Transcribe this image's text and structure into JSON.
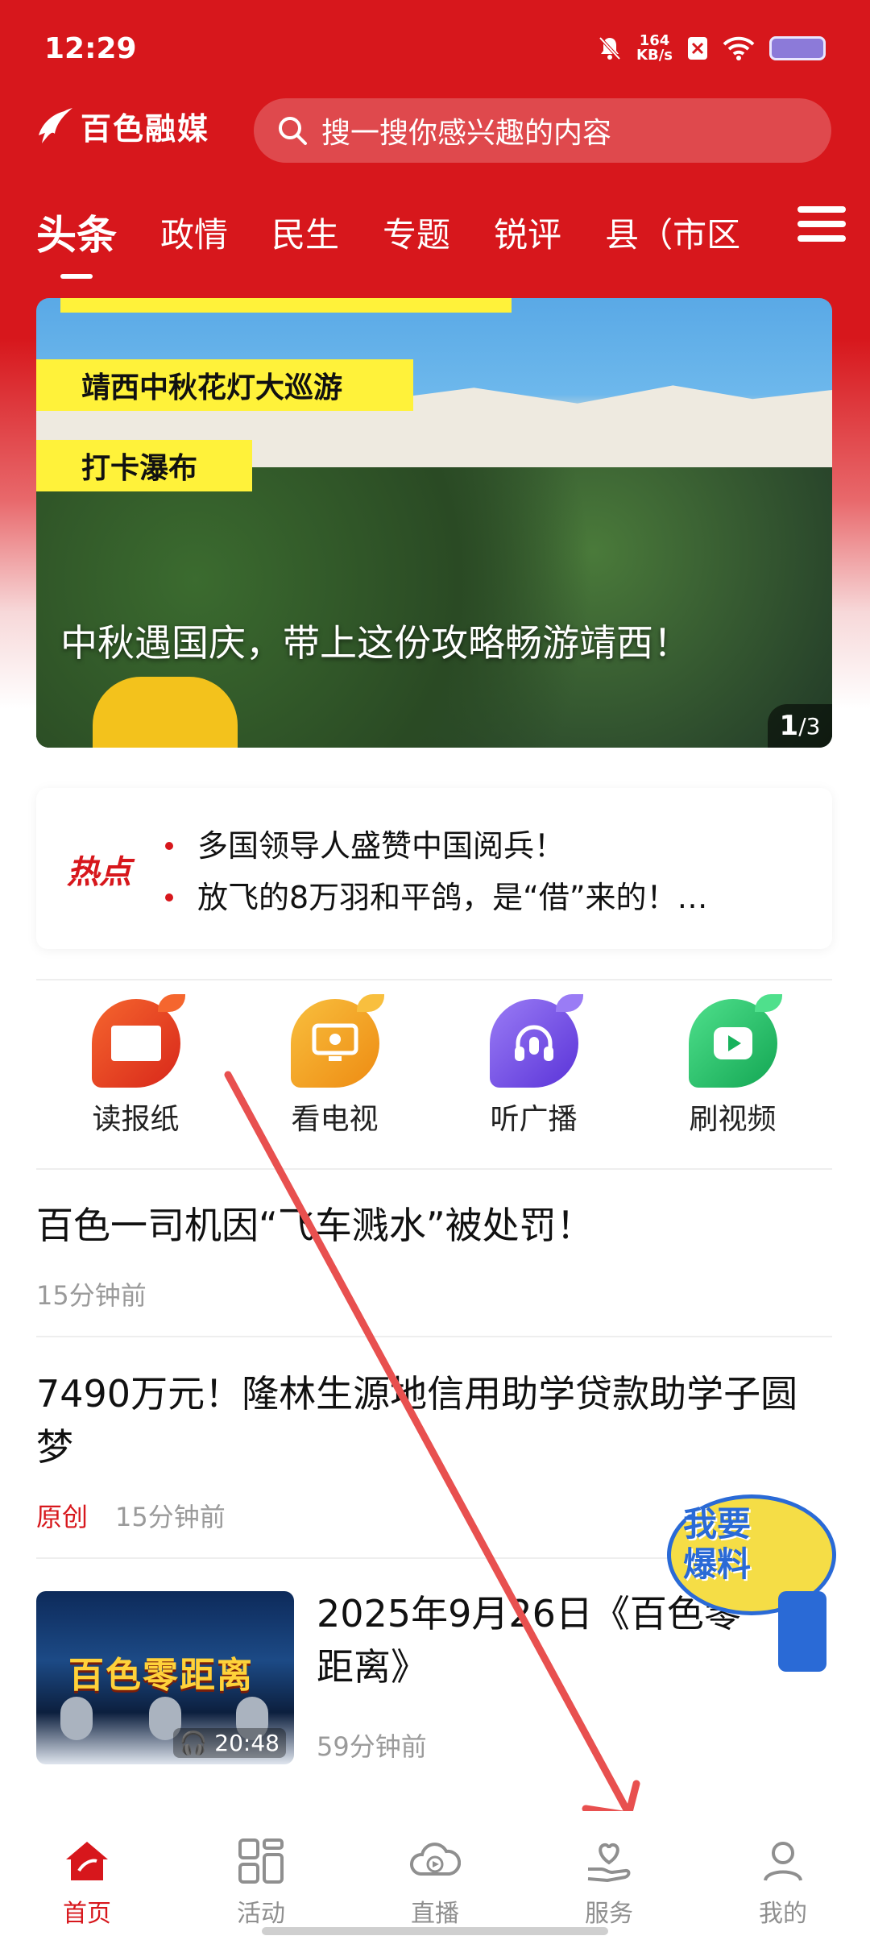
{
  "status_bar": {
    "time": "12:29",
    "net_speed_value": "164",
    "net_speed_unit": "KB/s"
  },
  "header": {
    "logo_text": "百色融媒",
    "search_placeholder": "搜一搜你感兴趣的内容",
    "tabs": [
      {
        "label": "头条",
        "active": true
      },
      {
        "label": "政情"
      },
      {
        "label": "民生"
      },
      {
        "label": "专题"
      },
      {
        "label": "锐评"
      },
      {
        "label": "县（市区"
      }
    ]
  },
  "banner": {
    "tag1": "靖西中秋花灯大巡游",
    "tag2": "打卡瀑布",
    "caption": "中秋遇国庆，带上这份攻略畅游靖西！",
    "pager_current": "1",
    "pager_total": "/3"
  },
  "hot": {
    "label": "热点",
    "items": [
      "多国领导人盛赞中国阅兵！",
      "放飞的8万羽和平鸽，是“借”来的！…"
    ]
  },
  "quick_actions": [
    {
      "label": "读报纸",
      "color": "#e8431e"
    },
    {
      "label": "看电视",
      "color": "#f2a020"
    },
    {
      "label": "听广播",
      "color": "#6b4fe0"
    },
    {
      "label": "刷视频",
      "color": "#21c16a"
    }
  ],
  "news": [
    {
      "title": "百色一司机因“飞车溅水”被处罚！",
      "time": "15分钟前"
    },
    {
      "title": "7490万元！隆林生源地信用助学贷款助学子圆梦",
      "tag": "原创",
      "time": "15分钟前"
    },
    {
      "title": "2025年9月26日《百色零距离》",
      "time": "59分钟前",
      "thumb_title": "百色零距离",
      "duration": "20:48"
    }
  ],
  "report_badge": {
    "line1": "我要",
    "line2": "爆料"
  },
  "bottom_nav": [
    {
      "label": "首页",
      "active": true
    },
    {
      "label": "活动"
    },
    {
      "label": "直播"
    },
    {
      "label": "服务"
    },
    {
      "label": "我的"
    }
  ],
  "colors": {
    "brand_red": "#d7171c",
    "annotation_arrow": "#e8504f"
  }
}
